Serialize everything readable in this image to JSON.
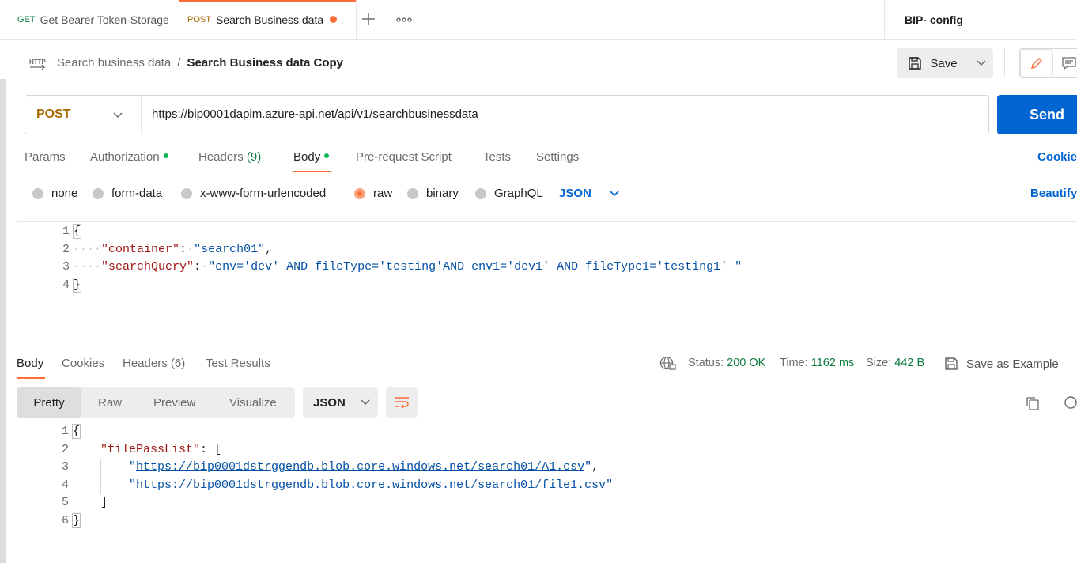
{
  "tabs": [
    {
      "method": "GET",
      "title": "Get Bearer Token-Storage"
    },
    {
      "method": "POST",
      "title": "Search Business data"
    }
  ],
  "environment": "BIP- config",
  "breadcrumb": {
    "parent": "Search business data",
    "separator": "/",
    "current": "Search Business data Copy"
  },
  "toolbar": {
    "save_label": "Save"
  },
  "request": {
    "method": "POST",
    "url": "https://bip0001dapim.azure-api.net/api/v1/searchbusinessdata",
    "send_label": "Send"
  },
  "request_tabs": {
    "params": "Params",
    "authorization": "Authorization",
    "headers": "Headers",
    "headers_count": "(9)",
    "body": "Body",
    "pre_request": "Pre-request Script",
    "tests": "Tests",
    "settings": "Settings",
    "cookies": "Cookies"
  },
  "body_types": {
    "none": "none",
    "form_data": "form-data",
    "urlencoded": "x-www-form-urlencoded",
    "raw": "raw",
    "binary": "binary",
    "graphql": "GraphQL",
    "selected": "raw",
    "format": "JSON",
    "beautify": "Beautify"
  },
  "request_body": {
    "line_numbers": [
      "1",
      "2",
      "3",
      "4"
    ],
    "open_brace": "{",
    "close_brace": "}",
    "key1": "\"container\"",
    "val1": "\"search01\"",
    "key2": "\"searchQuery\"",
    "val2": "\"env='dev' AND fileType='testing'AND env1='dev1' AND fileType1='testing1' \""
  },
  "response_tabs": {
    "body": "Body",
    "cookies": "Cookies",
    "headers": "Headers",
    "headers_count": "(6)",
    "test_results": "Test Results"
  },
  "response_meta": {
    "status_label": "Status:",
    "status_value": "200 OK",
    "time_label": "Time:",
    "time_value": "1162 ms",
    "size_label": "Size:",
    "size_value": "442 B",
    "save_example": "Save as Example"
  },
  "response_view": {
    "pretty": "Pretty",
    "raw": "Raw",
    "preview": "Preview",
    "visualize": "Visualize",
    "format": "JSON"
  },
  "response_body": {
    "line_numbers": [
      "1",
      "2",
      "3",
      "4",
      "5",
      "6"
    ],
    "open_brace": "{",
    "close_brace": "}",
    "key": "\"filePassList\"",
    "open_bracket": "[",
    "close_bracket": "]",
    "url1": "https://bip0001dstrggendb.blob.core.windows.net/search01/A1.csv",
    "url2": "https://bip0001dstrggendb.blob.core.windows.net/search01/file1.csv"
  },
  "icons": [
    "http-icon",
    "save-icon",
    "chevron-down-icon",
    "edit-icon",
    "comment-icon",
    "plus-icon",
    "more-icon",
    "globe-lock-icon",
    "wrap-icon",
    "copy-icon",
    "search-icon"
  ],
  "colors": {
    "accent": "#ff6c37",
    "primary": "#0265d2",
    "success": "#0b7a3e",
    "post": "#a86b00"
  }
}
